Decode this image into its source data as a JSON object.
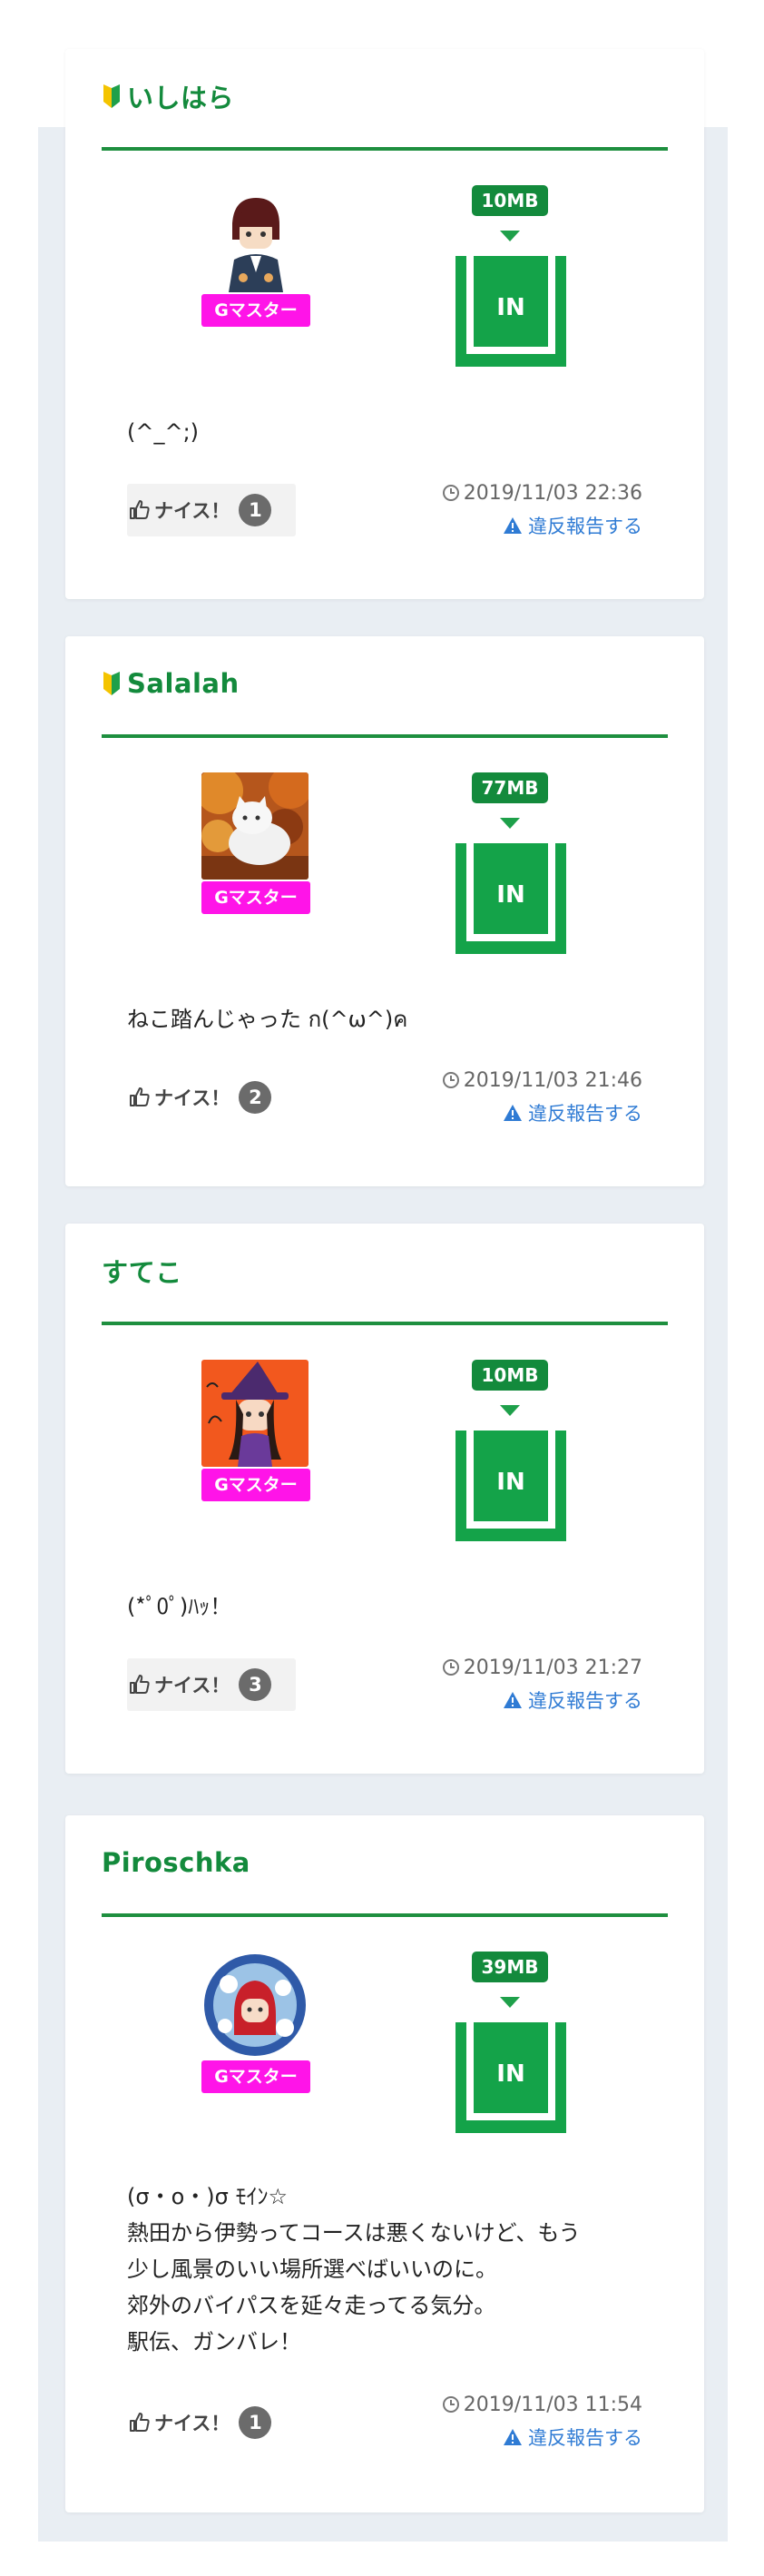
{
  "labels": {
    "rank": "Gマスター",
    "in": "IN",
    "nice": "ナイス！",
    "report": "違反報告する"
  },
  "colors": {
    "accent_green": "#138a3c",
    "rank_magenta": "#ff14e8",
    "link_blue": "#2f7bd4"
  },
  "posts": [
    {
      "name": "いしはら",
      "beginner": true,
      "avatar_icon": "anime-boy-avatar-icon",
      "size": "10MB",
      "comment": "(^_^;)",
      "nice_count": "1",
      "timestamp": "2019/11/03 22:36"
    },
    {
      "name": "Salalah",
      "beginner": true,
      "avatar_icon": "white-cat-autumn-avatar-icon",
      "size": "77MB",
      "comment": "ねこ踏んじゃった ก(^ω^)ค",
      "nice_count": "2",
      "timestamp": "2019/11/03 21:46"
    },
    {
      "name": "すてこ",
      "beginner": false,
      "avatar_icon": "witch-girl-avatar-icon",
      "size": "10MB",
      "comment": "(*ﾟ0ﾟ)ﾊｯ！",
      "nice_count": "3",
      "timestamp": "2019/11/03 21:27"
    },
    {
      "name": "Piroschka",
      "beginner": false,
      "avatar_icon": "red-hood-avatar-icon",
      "size": "39MB",
      "comment": "(σ・ο・)σ ﾓｲﾝ☆\n熱田から伊勢ってコースは悪くないけど、もう\n少し風景のいい場所選べばいいのに。\n郊外のバイパスを延々走ってる気分。\n駅伝、ガンバレ！",
      "nice_count": "1",
      "timestamp": "2019/11/03 11:54"
    }
  ]
}
